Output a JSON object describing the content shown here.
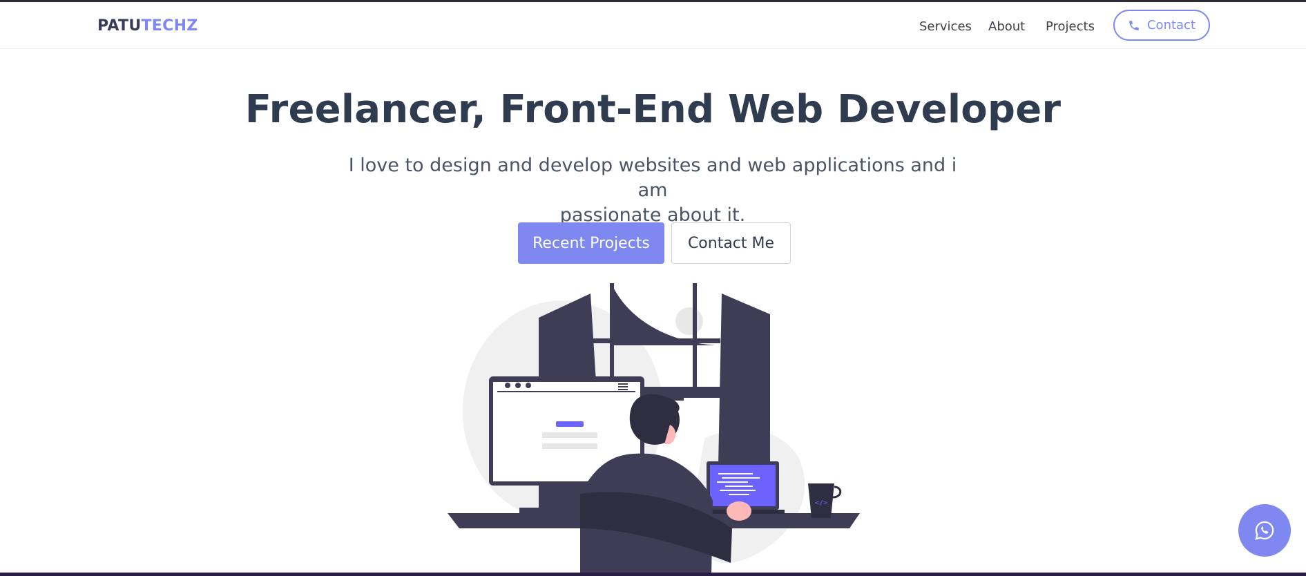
{
  "brand": {
    "part1": "PATU",
    "part2": "TECHZ"
  },
  "nav": {
    "links": [
      "Services",
      "About",
      "Projects"
    ],
    "contact_label": "Contact",
    "contact_icon": "phone-icon"
  },
  "hero": {
    "title": "Freelancer, Front-End Web Developer",
    "subtitle_line1": "I love to design and develop websites and web applications and i am",
    "subtitle_line2": "passionate about it.",
    "primary_button": "Recent Projects",
    "secondary_button": "Contact Me"
  },
  "illustration": {
    "subject": "person-at-desk-with-monitor-and-laptop"
  },
  "floating_button": {
    "icon": "whatsapp-icon"
  },
  "colors": {
    "accent": "#7f88f0",
    "heading": "#2f3b4f",
    "dark_figure": "#3f3d56",
    "bottom_stripe": "#2a1d45"
  }
}
